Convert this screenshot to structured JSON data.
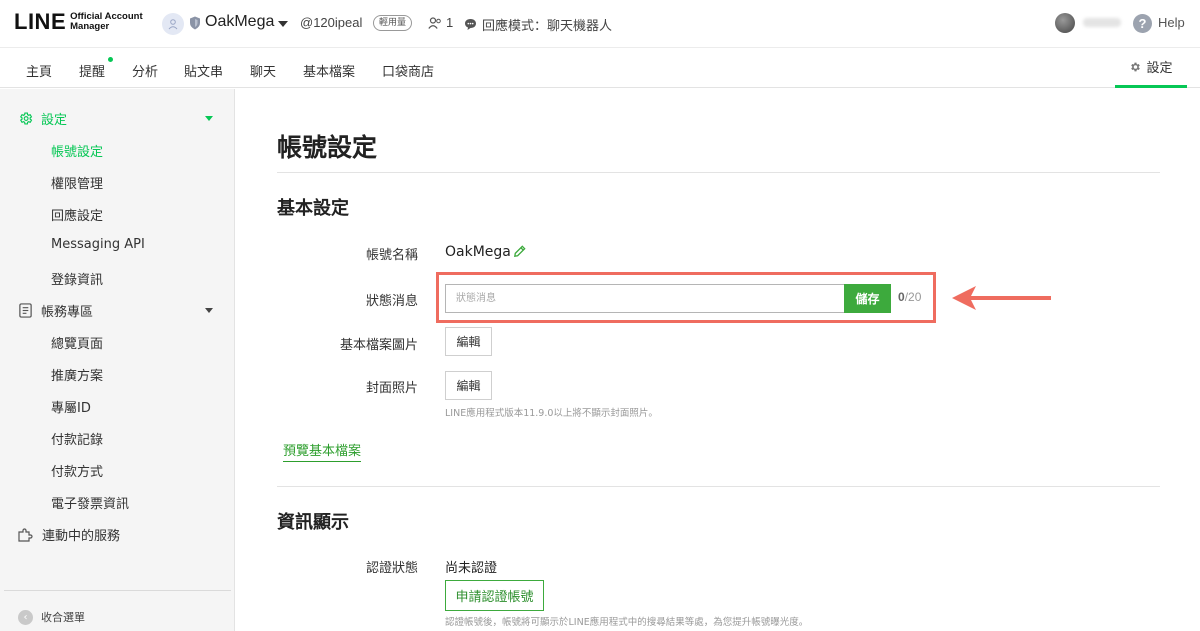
{
  "header": {
    "logo_main": "LINE",
    "logo_sub_line1": "Official Account",
    "logo_sub_line2": "Manager",
    "account_name": "OakMega",
    "account_id": "@120ipeal",
    "plan_badge": "輕用量",
    "member_count": "1",
    "response_mode": "回應模式：聊天機器人",
    "help_label": "Help"
  },
  "nav": {
    "tabs": [
      "主頁",
      "提醒",
      "分析",
      "貼文串",
      "聊天",
      "基本檔案",
      "口袋商店"
    ],
    "settings_label": "設定"
  },
  "sidebar": {
    "settings_section": "設定",
    "settings_items": [
      "帳號設定",
      "權限管理",
      "回應設定",
      "Messaging API",
      "登錄資訊"
    ],
    "billing_section": "帳務專區",
    "billing_items": [
      "總覽頁面",
      "推廣方案",
      "專屬ID",
      "付款記錄",
      "付款方式",
      "電子發票資訊"
    ],
    "services_section": "連動中的服務",
    "collapse_label": "收合選單"
  },
  "main": {
    "page_title": "帳號設定",
    "basic_section_title": "基本設定",
    "account_name_label": "帳號名稱",
    "account_name_value": "OakMega",
    "status_label": "狀態消息",
    "status_placeholder": "狀態消息",
    "save_label": "儲存",
    "char_count_current": "0",
    "char_count_max": "/20",
    "profile_image_label": "基本檔案圖片",
    "edit_label": "編輯",
    "cover_label": "封面照片",
    "cover_hint": "LINE應用程式版本11.9.0以上將不顯示封面照片。",
    "preview_link": "預覽基本檔案",
    "info_section_title": "資訊顯示",
    "verify_status_label": "認證狀態",
    "verify_status_value": "尚未認證",
    "verify_button": "申請認證帳號",
    "verify_hint": "認證帳號後，帳號將可顯示於LINE應用程式中的搜尋結果等處，為您提升帳號曝光度。"
  },
  "colors": {
    "brand_green": "#06c755",
    "save_green": "#3daa3d",
    "highlight_red": "#ef6c5f"
  },
  "icons": [
    "account-avatar-icon",
    "shield-icon",
    "member-icon",
    "chat-bubble-icon",
    "help-icon",
    "gear-icon",
    "document-icon",
    "puzzle-icon",
    "pencil-icon",
    "arrow-left-icon",
    "collapse-left-icon"
  ]
}
